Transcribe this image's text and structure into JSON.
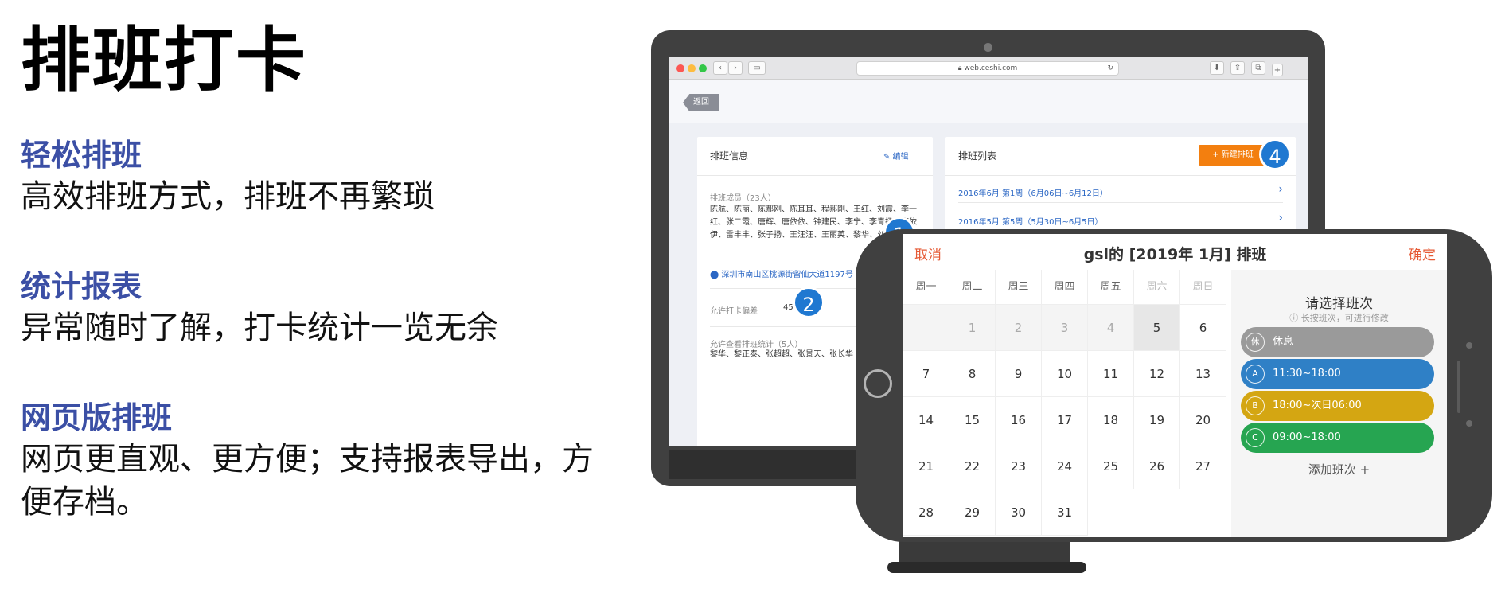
{
  "page": {
    "title": "排班打卡",
    "features": [
      {
        "heading": "轻松排班",
        "desc": "高效排班方式，排班不再繁琐"
      },
      {
        "heading": "统计报表",
        "desc": "异常随时了解，打卡统计一览无余"
      },
      {
        "heading": "网页版排班",
        "desc": "网页更直观、更方便；支持报表导出，方便存档。"
      }
    ]
  },
  "browser": {
    "url": "web.ceshi.com",
    "back_label": "返回"
  },
  "schedule_info": {
    "title": "排班信息",
    "edit_label": "编辑",
    "members_label": "排班成员（23人）",
    "members_text": "陈航、陈丽、陈郝刚、陈耳耳、程郝刚、王红、刘霞、李一红、张二霞、唐辉、唐依依、钟建民、李宁、李青扬、李依伊、雷丰丰、张子扬、王汪汪、王丽英、黎华、刘丹丹、钟佳",
    "address": "深圳市南山区桃源街留仙大道1197号",
    "range_label": "允许打卡偏差",
    "range_value": "450米",
    "viewers_label": "允许查看排班统计（5人）",
    "viewers_text": "黎华、黎正泰、张超超、张景天、张长华"
  },
  "schedule_list": {
    "title": "排班列表",
    "new_label": "+ 新建排班",
    "items": [
      "2016年6月 第1周（6月06日~6月12日）",
      "2016年5月 第5周（5月30日~6月5日）"
    ]
  },
  "badges": {
    "one": "1",
    "two": "2",
    "four": "4"
  },
  "tablet": {
    "cancel": "取消",
    "confirm": "确定",
    "title": "gsl的 [2019年 1月] 排班",
    "weekdays": [
      "周一",
      "周二",
      "周三",
      "周四",
      "周五",
      "周六",
      "周日"
    ],
    "days": [
      "",
      "1",
      "2",
      "3",
      "4",
      "5",
      "6",
      "7",
      "8",
      "9",
      "10",
      "11",
      "12",
      "13",
      "14",
      "15",
      "16",
      "17",
      "18",
      "19",
      "20",
      "21",
      "22",
      "23",
      "24",
      "25",
      "26",
      "27",
      "28",
      "29",
      "30",
      "31"
    ],
    "selected_day": "5",
    "panel_title": "请选择班次",
    "panel_hint": "ⓘ 长按班次，可进行修改",
    "shifts": [
      {
        "code": "休",
        "label": "休息",
        "color": "#9a9a9a"
      },
      {
        "code": "A",
        "label": "11:30~18:00",
        "color": "#2f80c6"
      },
      {
        "code": "B",
        "label": "18:00~次日06:00",
        "color": "#d4a612"
      },
      {
        "code": "C",
        "label": "09:00~18:00",
        "color": "#26a551"
      }
    ],
    "add_label": "添加班次 +"
  }
}
